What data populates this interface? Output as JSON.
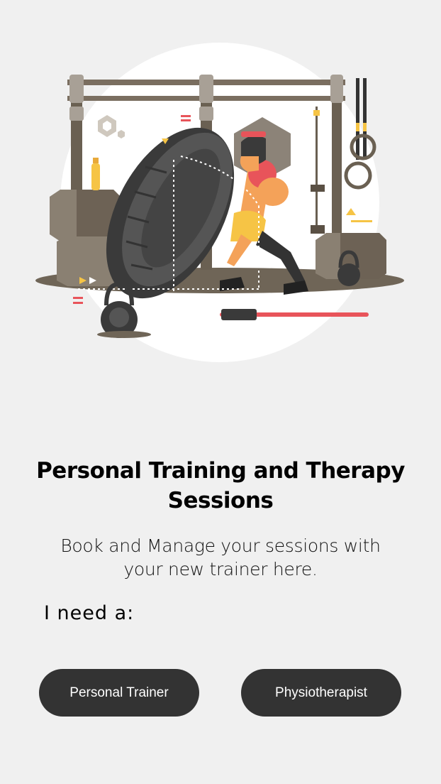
{
  "intro": {
    "title": "Personal Training and Therapy Sessions",
    "subtitle": "Book and Manage your sessions with your new trainer here.",
    "need_label": "I need a:"
  },
  "options": {
    "trainer_label": "Personal Trainer",
    "physio_label": "Physiotherapist"
  },
  "colors": {
    "background": "#f0f0f0",
    "button": "#333333",
    "button_text": "#ffffff",
    "accent_red": "#e8545a",
    "accent_yellow": "#f6c445",
    "skin": "#f4a259"
  },
  "illustration": {
    "subject": "athlete flipping tire in gym",
    "icons": [
      "tire-icon",
      "kettlebell-icon",
      "gymnastic-rings-icon",
      "water-bottle-icon",
      "hexagon-icon",
      "pull-up-bar-icon"
    ]
  }
}
